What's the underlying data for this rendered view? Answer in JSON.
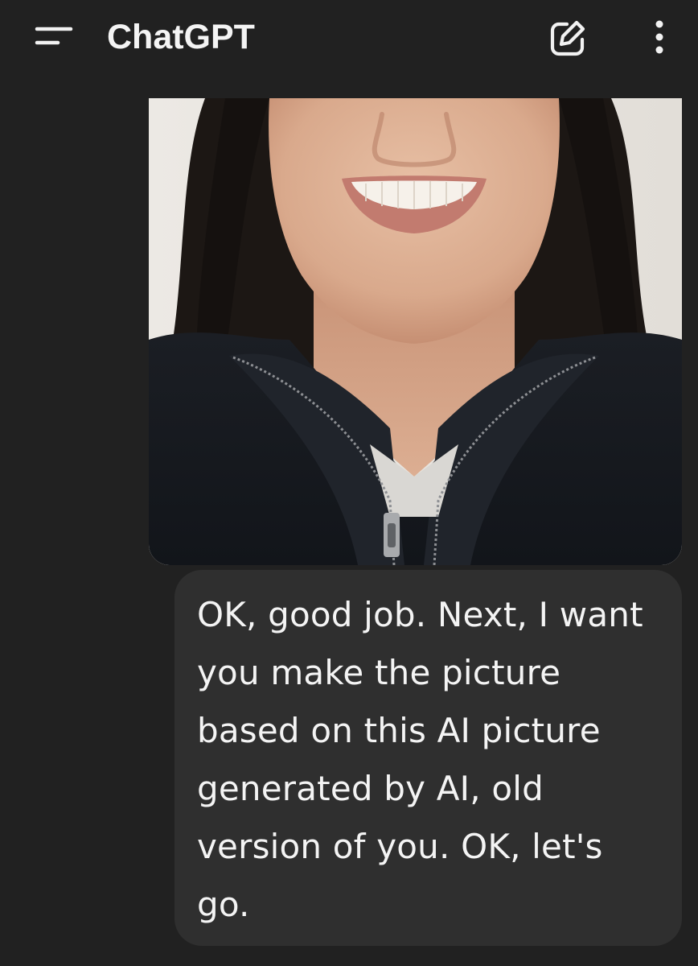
{
  "header": {
    "title": "ChatGPT",
    "menu_icon": "menu-icon",
    "new_chat_icon": "edit-square-icon",
    "more_icon": "more-vertical-icon"
  },
  "conversation": {
    "image_message": {
      "alt": "Photo of a smiling woman with long dark hair wearing a black zip-up fleece jacket"
    },
    "user_message": {
      "text": "OK, good job. Next, I want you make the picture based on this AI picture generated by AI, old version of you. OK, let's go."
    }
  },
  "colors": {
    "background": "#212121",
    "bubble": "#2f2f2f",
    "text": "#f4f4f4"
  }
}
